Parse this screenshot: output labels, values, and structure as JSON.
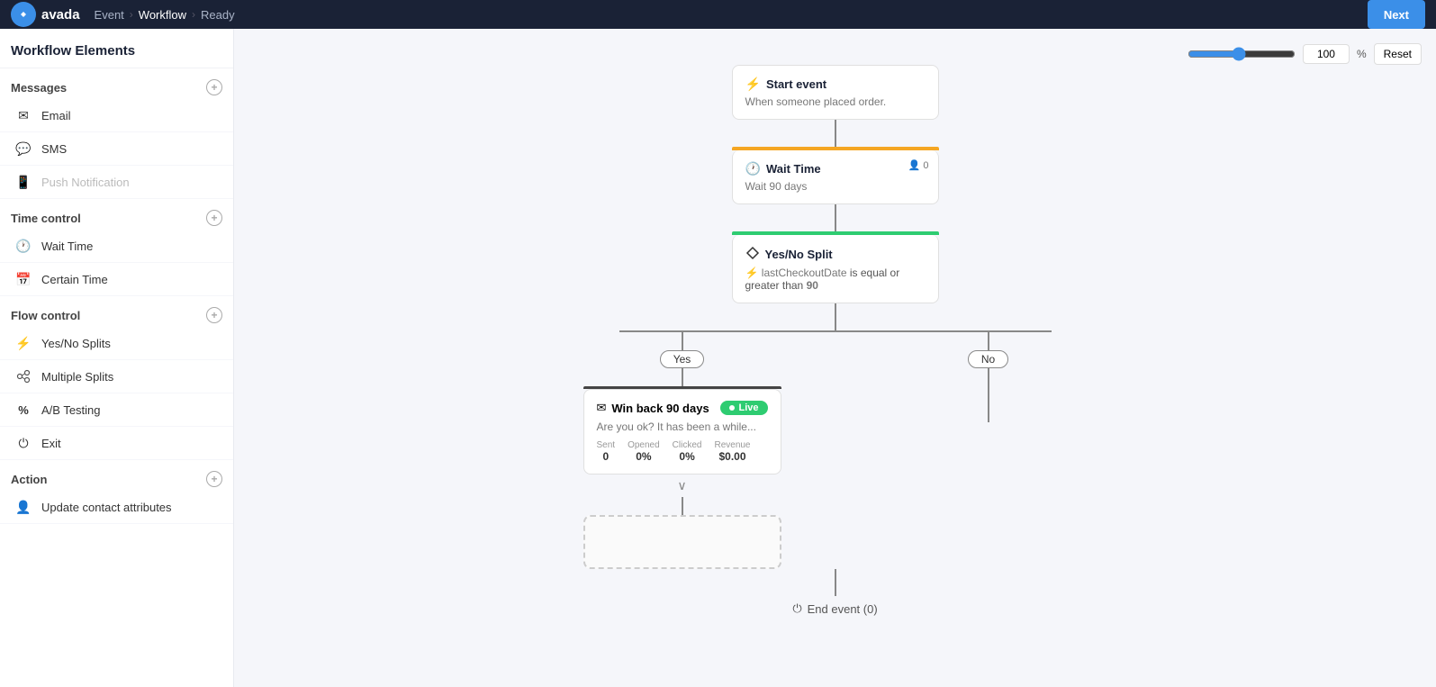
{
  "nav": {
    "logo": "avada",
    "breadcrumbs": [
      "Event",
      "Workflow",
      "Ready"
    ],
    "active_crumb": "Workflow",
    "next_label": "Next"
  },
  "sidebar": {
    "title": "Workflow Elements",
    "sections": [
      {
        "id": "messages",
        "label": "Messages",
        "items": [
          {
            "id": "email",
            "label": "Email",
            "icon": "✉"
          },
          {
            "id": "sms",
            "label": "SMS",
            "icon": "💬"
          },
          {
            "id": "push",
            "label": "Push Notification",
            "icon": "📱",
            "disabled": true
          }
        ]
      },
      {
        "id": "time-control",
        "label": "Time control",
        "items": [
          {
            "id": "wait-time",
            "label": "Wait Time",
            "icon": "🕐"
          },
          {
            "id": "certain-time",
            "label": "Certain Time",
            "icon": "📅"
          }
        ]
      },
      {
        "id": "flow-control",
        "label": "Flow control",
        "items": [
          {
            "id": "yes-no-splits",
            "label": "Yes/No Splits",
            "icon": "⚡"
          },
          {
            "id": "multiple-splits",
            "label": "Multiple Splits",
            "icon": "👥"
          },
          {
            "id": "ab-testing",
            "label": "A/B Testing",
            "icon": "%"
          },
          {
            "id": "exit",
            "label": "Exit",
            "icon": "⏻"
          }
        ]
      },
      {
        "id": "action",
        "label": "Action",
        "items": [
          {
            "id": "update-contact",
            "label": "Update contact attributes",
            "icon": "👤"
          }
        ]
      }
    ]
  },
  "zoom": {
    "value": "100",
    "percent_label": "%",
    "reset_label": "Reset"
  },
  "workflow": {
    "start_event": {
      "title": "Start event",
      "subtitle": "When someone placed order."
    },
    "wait_time": {
      "title": "Wait Time",
      "subtitle": "Wait 90 days",
      "users": "0"
    },
    "yes_no_split": {
      "title": "Yes/No Split",
      "condition_field": "lastCheckoutDate",
      "condition_operator": "is equal or greater than",
      "condition_value": "90"
    },
    "yes_label": "Yes",
    "no_label": "No",
    "email_node": {
      "title": "Win back 90 days",
      "live_label": "Live",
      "preview": "Are you ok? It has been a while...",
      "stats": {
        "sent_label": "Sent",
        "sent_value": "0",
        "opened_label": "Opened",
        "opened_value": "0%",
        "clicked_label": "Clicked",
        "clicked_value": "0%",
        "revenue_label": "Revenue",
        "revenue_value": "$0.00"
      }
    },
    "end_event": {
      "title": "End event (0)"
    }
  }
}
